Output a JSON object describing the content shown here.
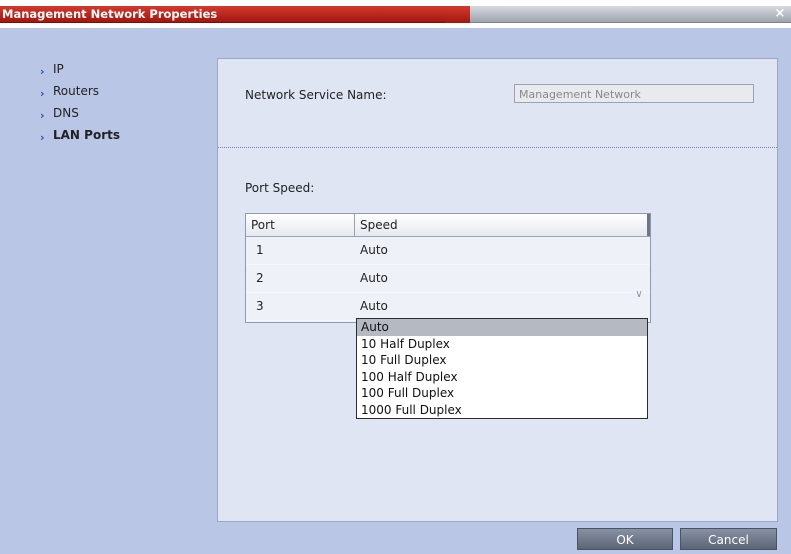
{
  "window": {
    "title": "Management Network Properties",
    "close_label": "×"
  },
  "sidebar": {
    "items": [
      {
        "label": "IP",
        "active": false
      },
      {
        "label": "Routers",
        "active": false
      },
      {
        "label": "DNS",
        "active": false
      },
      {
        "label": "LAN Ports",
        "active": true
      }
    ]
  },
  "form": {
    "service_name_label": "Network Service Name:",
    "service_name_value": "Management Network",
    "port_speed_label": "Port Speed:"
  },
  "grid": {
    "columns": [
      "Port",
      "Speed"
    ],
    "rows": [
      {
        "port": "1",
        "speed": "Auto"
      },
      {
        "port": "2",
        "speed": "Auto"
      },
      {
        "port": "3",
        "speed": "Auto"
      }
    ]
  },
  "dropdown": {
    "selected": "Auto",
    "options": [
      "Auto",
      "10 Half Duplex",
      "10 Full Duplex",
      "100 Half Duplex",
      "100 Full Duplex",
      "1000 Full Duplex"
    ]
  },
  "buttons": {
    "ok": "OK",
    "cancel": "Cancel"
  },
  "icons": {
    "nav_arrow": "chevron-right-icon",
    "dropdown_arrow": "chevron-down-icon",
    "close": "close-icon"
  },
  "colors": {
    "title_bar": "#b8221a",
    "dialog_bg": "#b9c6e6",
    "panel_bg": "#dfe5f3",
    "button": "#6b7486"
  }
}
